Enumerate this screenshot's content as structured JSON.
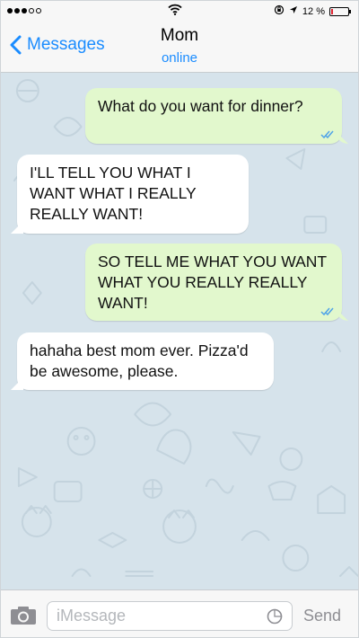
{
  "status_bar": {
    "battery": "12 %",
    "battery_level": 0.12
  },
  "header": {
    "back_label": "Messages",
    "contact_name": "Mom",
    "contact_status": "online"
  },
  "messages": [
    {
      "direction": "outgoing",
      "text": "What do you want for dinner?"
    },
    {
      "direction": "incoming",
      "text": "I'LL TELL YOU WHAT I WANT WHAT I REALLY REALLY WANT!"
    },
    {
      "direction": "outgoing",
      "text": "SO TELL ME WHAT YOU WANT WHAT YOU REALLY REALLY WANT!"
    },
    {
      "direction": "incoming",
      "text": "hahaha best mom ever. Pizza'd be awesome, please."
    }
  ],
  "composer": {
    "placeholder": "iMessage",
    "send_label": "Send"
  },
  "colors": {
    "accent": "#1a8cff",
    "outgoing_bubble": "#e2f8cd",
    "incoming_bubble": "#ffffff",
    "chat_background": "#d6e3eb",
    "read_ticks": "#4fa3e8",
    "battery_low": "#e0212f"
  },
  "icons": {
    "back": "chevron-left-icon",
    "camera": "camera-icon",
    "wifi": "wifi-icon",
    "location": "location-arrow-icon",
    "lock": "rotation-lock-icon",
    "ticks": "double-check-icon",
    "composer_field": "sticker-icon"
  }
}
